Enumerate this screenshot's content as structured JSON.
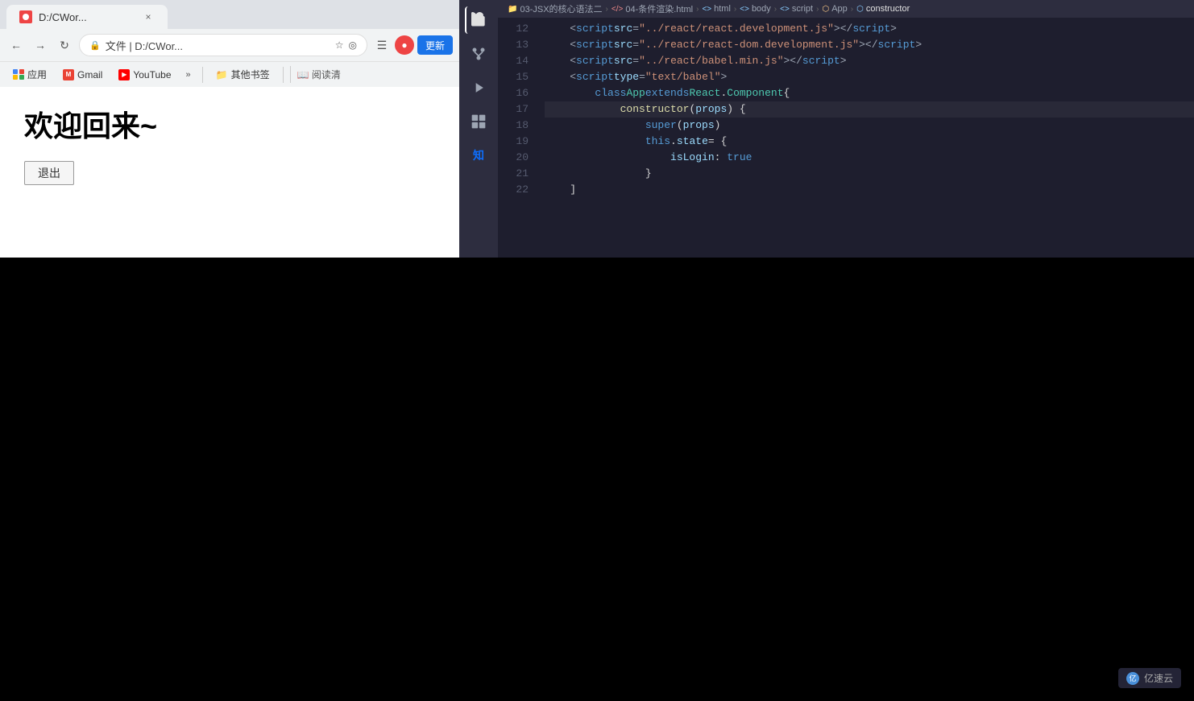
{
  "browser": {
    "tab_title": "D:/CWor...",
    "address": "D:/CWor...",
    "update_btn": "更新",
    "bookmarks": {
      "apps_label": "应用",
      "gmail_label": "Gmail",
      "youtube_label": "YouTube",
      "more_label": "»",
      "other_label": "其他书签",
      "reading_label": "阅读清"
    }
  },
  "page": {
    "welcome_text": "欢迎回来~",
    "logout_btn": "退出"
  },
  "breadcrumb": {
    "items": [
      {
        "text": "03-JSX的核心语法二",
        "icon": "folder"
      },
      {
        "text": "04-条件渲染.html",
        "icon": "file-html"
      },
      {
        "text": "html",
        "icon": "tag"
      },
      {
        "text": "body",
        "icon": "tag"
      },
      {
        "text": "script",
        "icon": "tag"
      },
      {
        "text": "App",
        "icon": "class"
      },
      {
        "text": "constructor",
        "icon": "method"
      }
    ]
  },
  "code": {
    "lines": [
      {
        "num": 12,
        "content": "    <script src=\"../react/react.development.js\"><\\/script>"
      },
      {
        "num": 13,
        "content": "    <script src=\"../react/react-dom.development.js\"><\\/script>"
      },
      {
        "num": 14,
        "content": "    <script src=\"../react/babel.min.js\"><\\/script>"
      },
      {
        "num": 15,
        "content": "    <script type=\"text/babel\">"
      },
      {
        "num": 16,
        "content": "        class App extends React.Component {"
      },
      {
        "num": 17,
        "content": "            constructor(props) {"
      },
      {
        "num": 18,
        "content": "                super(props)"
      },
      {
        "num": 19,
        "content": "                this.state = {"
      },
      {
        "num": 20,
        "content": "                    isLogin: true"
      },
      {
        "num": 21,
        "content": "                }"
      },
      {
        "num": 22,
        "content": "    ]"
      }
    ]
  },
  "watermark": {
    "logo": "亿",
    "text": "亿速云"
  }
}
